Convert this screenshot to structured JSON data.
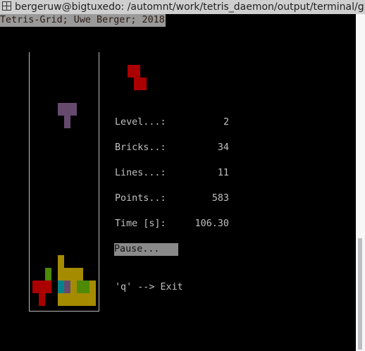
{
  "window": {
    "title": "bergeruw@bigtuxedo: /automnt/work/tetris_daemon/output/terminal/g",
    "icon": "terminal-icon"
  },
  "header": "Tetris-Grid; Uwe Berger; 2018",
  "stats": [
    {
      "label": "Level...:",
      "value": "2"
    },
    {
      "label": "Bricks..:",
      "value": "34"
    },
    {
      "label": "Lines...:",
      "value": "11"
    },
    {
      "label": "Points..:",
      "value": "583"
    },
    {
      "label": "Time [s]:",
      "value": "106.30"
    }
  ],
  "pause_label": "Pause...",
  "exit_hint": "'q' --> Exit",
  "colors": {
    "red": "#aa0000",
    "green": "#4e8a06",
    "yellow": "#a58b00",
    "cyan": "#06838a",
    "purple": "#654a6e"
  },
  "board": {
    "columns": 11,
    "next_piece": "Z",
    "falling_piece": "T"
  }
}
